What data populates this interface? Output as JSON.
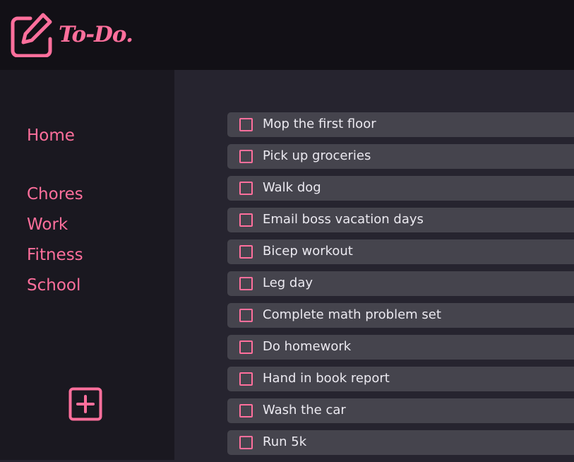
{
  "app": {
    "title": "To-Do.",
    "accent_color": "#ff6f9c",
    "logo_icon": "edit-square-icon"
  },
  "sidebar": {
    "home_label": "Home",
    "projects": [
      {
        "label": "Chores"
      },
      {
        "label": "Work"
      },
      {
        "label": "Fitness"
      },
      {
        "label": "School"
      }
    ],
    "add_icon": "plus-square-icon"
  },
  "tasks": [
    {
      "label": "Mop the first floor",
      "checked": false
    },
    {
      "label": "Pick up groceries",
      "checked": false
    },
    {
      "label": "Walk dog",
      "checked": false
    },
    {
      "label": "Email boss vacation days",
      "checked": false
    },
    {
      "label": "Bicep workout",
      "checked": false
    },
    {
      "label": "Leg day",
      "checked": false
    },
    {
      "label": "Complete math problem set",
      "checked": false
    },
    {
      "label": "Do homework",
      "checked": false
    },
    {
      "label": "Hand in book report",
      "checked": false
    },
    {
      "label": "Wash the car",
      "checked": false
    },
    {
      "label": "Run 5k",
      "checked": false
    }
  ]
}
